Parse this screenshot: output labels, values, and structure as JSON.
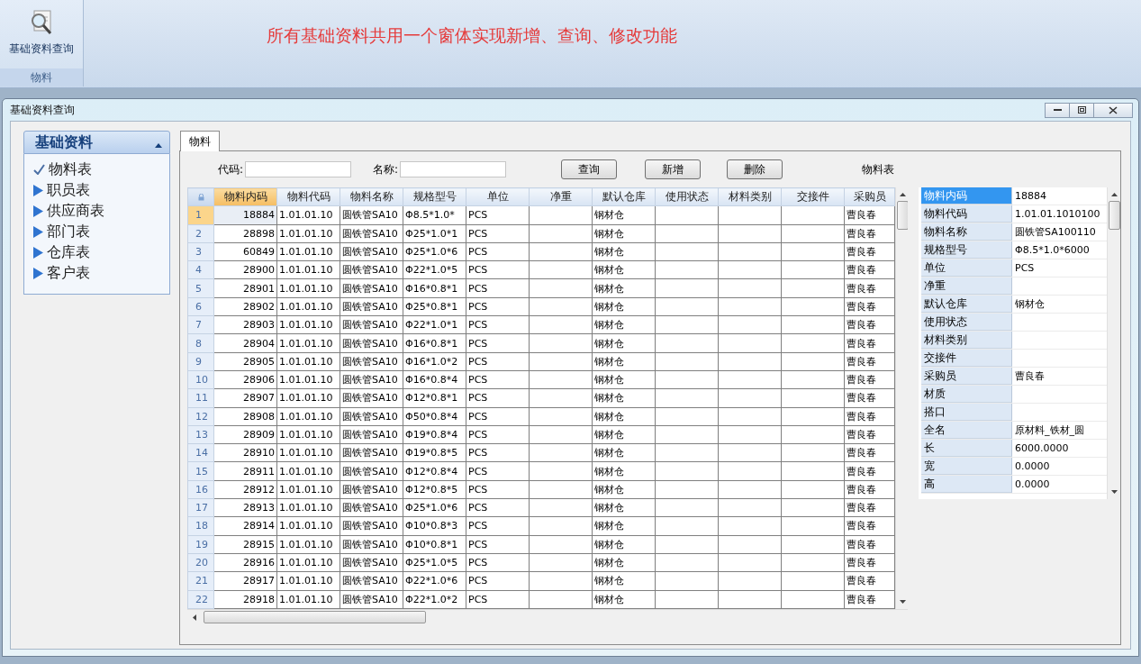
{
  "ribbon": {
    "button": "基础资料查询",
    "group": "物料"
  },
  "banner": "所有基础资料共用一个窗体实现新增、查询、修改功能",
  "window": {
    "title": "基础资料查询"
  },
  "nav": {
    "title": "基础资料",
    "expanded": true,
    "items": [
      {
        "label": "物料表",
        "selected": true
      },
      {
        "label": "职员表",
        "selected": false
      },
      {
        "label": "供应商表",
        "selected": false
      },
      {
        "label": "部门表",
        "selected": false
      },
      {
        "label": "仓库表",
        "selected": false
      },
      {
        "label": "客户表",
        "selected": false
      }
    ]
  },
  "tabs": [
    {
      "label": "物料",
      "selected": true
    }
  ],
  "filters": [
    {
      "label": "代码:"
    },
    {
      "label": "名称:"
    }
  ],
  "buttons": [
    "查询",
    "新增",
    "删除"
  ],
  "table_caption": "物料表",
  "grid": {
    "columns": [
      {
        "label": "物料内码",
        "sorted": true
      },
      {
        "label": "物料代码",
        "sorted": false
      },
      {
        "label": "物料名称",
        "sorted": false
      },
      {
        "label": "规格型号",
        "sorted": false
      },
      {
        "label": "单位",
        "sorted": false
      },
      {
        "label": "净重",
        "sorted": false
      },
      {
        "label": "默认仓库",
        "sorted": false
      },
      {
        "label": "使用状态",
        "sorted": false
      },
      {
        "label": "材料类别",
        "sorted": false
      },
      {
        "label": "交接件",
        "sorted": false
      },
      {
        "label": "采购员",
        "sorted": false
      }
    ],
    "rows": [
      {
        "num": "1",
        "selected": true,
        "cells": [
          "18884",
          "1.01.01.10",
          "圆铁管SA10",
          "Φ8.5*1.0*",
          "PCS",
          "",
          "钢材仓",
          "",
          "",
          "",
          "曹良春"
        ]
      },
      {
        "num": "2",
        "selected": false,
        "cells": [
          "28898",
          "1.01.01.10",
          "圆铁管SA10",
          "Φ25*1.0*1",
          "PCS",
          "",
          "钢材仓",
          "",
          "",
          "",
          "曹良春"
        ]
      },
      {
        "num": "3",
        "selected": false,
        "cells": [
          "60849",
          "1.01.01.10",
          "圆铁管SA10",
          "Φ25*1.0*6",
          "PCS",
          "",
          "钢材仓",
          "",
          "",
          "",
          "曹良春"
        ]
      },
      {
        "num": "4",
        "selected": false,
        "cells": [
          "28900",
          "1.01.01.10",
          "圆铁管SA10",
          "Φ22*1.0*5",
          "PCS",
          "",
          "钢材仓",
          "",
          "",
          "",
          "曹良春"
        ]
      },
      {
        "num": "5",
        "selected": false,
        "cells": [
          "28901",
          "1.01.01.10",
          "圆铁管SA10",
          "Φ16*0.8*1",
          "PCS",
          "",
          "钢材仓",
          "",
          "",
          "",
          "曹良春"
        ]
      },
      {
        "num": "6",
        "selected": false,
        "cells": [
          "28902",
          "1.01.01.10",
          "圆铁管SA10",
          "Φ25*0.8*1",
          "PCS",
          "",
          "钢材仓",
          "",
          "",
          "",
          "曹良春"
        ]
      },
      {
        "num": "7",
        "selected": false,
        "cells": [
          "28903",
          "1.01.01.10",
          "圆铁管SA10",
          "Φ22*1.0*1",
          "PCS",
          "",
          "钢材仓",
          "",
          "",
          "",
          "曹良春"
        ]
      },
      {
        "num": "8",
        "selected": false,
        "cells": [
          "28904",
          "1.01.01.10",
          "圆铁管SA10",
          "Φ16*0.8*1",
          "PCS",
          "",
          "钢材仓",
          "",
          "",
          "",
          "曹良春"
        ]
      },
      {
        "num": "9",
        "selected": false,
        "cells": [
          "28905",
          "1.01.01.10",
          "圆铁管SA10",
          "Φ16*1.0*2",
          "PCS",
          "",
          "钢材仓",
          "",
          "",
          "",
          "曹良春"
        ]
      },
      {
        "num": "10",
        "selected": false,
        "cells": [
          "28906",
          "1.01.01.10",
          "圆铁管SA10",
          "Φ16*0.8*4",
          "PCS",
          "",
          "钢材仓",
          "",
          "",
          "",
          "曹良春"
        ]
      },
      {
        "num": "11",
        "selected": false,
        "cells": [
          "28907",
          "1.01.01.10",
          "圆铁管SA10",
          "Φ12*0.8*1",
          "PCS",
          "",
          "钢材仓",
          "",
          "",
          "",
          "曹良春"
        ]
      },
      {
        "num": "12",
        "selected": false,
        "cells": [
          "28908",
          "1.01.01.10",
          "圆铁管SA10",
          "Φ50*0.8*4",
          "PCS",
          "",
          "钢材仓",
          "",
          "",
          "",
          "曹良春"
        ]
      },
      {
        "num": "13",
        "selected": false,
        "cells": [
          "28909",
          "1.01.01.10",
          "圆铁管SA10",
          "Φ19*0.8*4",
          "PCS",
          "",
          "钢材仓",
          "",
          "",
          "",
          "曹良春"
        ]
      },
      {
        "num": "14",
        "selected": false,
        "cells": [
          "28910",
          "1.01.01.10",
          "圆铁管SA10",
          "Φ19*0.8*5",
          "PCS",
          "",
          "钢材仓",
          "",
          "",
          "",
          "曹良春"
        ]
      },
      {
        "num": "15",
        "selected": false,
        "cells": [
          "28911",
          "1.01.01.10",
          "圆铁管SA10",
          "Φ12*0.8*4",
          "PCS",
          "",
          "钢材仓",
          "",
          "",
          "",
          "曹良春"
        ]
      },
      {
        "num": "16",
        "selected": false,
        "cells": [
          "28912",
          "1.01.01.10",
          "圆铁管SA10",
          "Φ12*0.8*5",
          "PCS",
          "",
          "钢材仓",
          "",
          "",
          "",
          "曹良春"
        ]
      },
      {
        "num": "17",
        "selected": false,
        "cells": [
          "28913",
          "1.01.01.10",
          "圆铁管SA10",
          "Φ25*1.0*6",
          "PCS",
          "",
          "钢材仓",
          "",
          "",
          "",
          "曹良春"
        ]
      },
      {
        "num": "18",
        "selected": false,
        "cells": [
          "28914",
          "1.01.01.10",
          "圆铁管SA10",
          "Φ10*0.8*3",
          "PCS",
          "",
          "钢材仓",
          "",
          "",
          "",
          "曹良春"
        ]
      },
      {
        "num": "19",
        "selected": false,
        "cells": [
          "28915",
          "1.01.01.10",
          "圆铁管SA10",
          "Φ10*0.8*1",
          "PCS",
          "",
          "钢材仓",
          "",
          "",
          "",
          "曹良春"
        ]
      },
      {
        "num": "20",
        "selected": false,
        "cells": [
          "28916",
          "1.01.01.10",
          "圆铁管SA10",
          "Φ25*1.0*5",
          "PCS",
          "",
          "钢材仓",
          "",
          "",
          "",
          "曹良春"
        ]
      },
      {
        "num": "21",
        "selected": false,
        "cells": [
          "28917",
          "1.01.01.10",
          "圆铁管SA10",
          "Φ22*1.0*6",
          "PCS",
          "",
          "钢材仓",
          "",
          "",
          "",
          "曹良春"
        ]
      },
      {
        "num": "22",
        "selected": false,
        "cells": [
          "28918",
          "1.01.01.10",
          "圆铁管SA10",
          "Φ22*1.0*2",
          "PCS",
          "",
          "钢材仓",
          "",
          "",
          "",
          "曹良春"
        ]
      }
    ]
  },
  "properties": [
    {
      "name": "物料内码",
      "value": "18884",
      "selected": true
    },
    {
      "name": "物料代码",
      "value": "1.01.01.1010100",
      "selected": false
    },
    {
      "name": "物料名称",
      "value": "圆铁管SA100110",
      "selected": false
    },
    {
      "name": "规格型号",
      "value": "Φ8.5*1.0*6000",
      "selected": false
    },
    {
      "name": "单位",
      "value": "PCS",
      "selected": false
    },
    {
      "name": "净重",
      "selected": false
    },
    {
      "name": "默认仓库",
      "value": "钢材仓",
      "selected": false
    },
    {
      "name": "使用状态",
      "selected": false
    },
    {
      "name": "材料类别",
      "selected": false
    },
    {
      "name": "交接件",
      "selected": false
    },
    {
      "name": "采购员",
      "value": "曹良春",
      "selected": false
    },
    {
      "name": "材质",
      "selected": false
    },
    {
      "name": "搭口",
      "selected": false
    },
    {
      "name": "全名",
      "value": "原材料_铁材_圆",
      "selected": false
    },
    {
      "name": "长",
      "value": "6000.0000",
      "selected": false
    },
    {
      "name": "宽",
      "value": "0.0000",
      "selected": false
    },
    {
      "name": "高",
      "value": "0.0000",
      "selected": false
    }
  ]
}
